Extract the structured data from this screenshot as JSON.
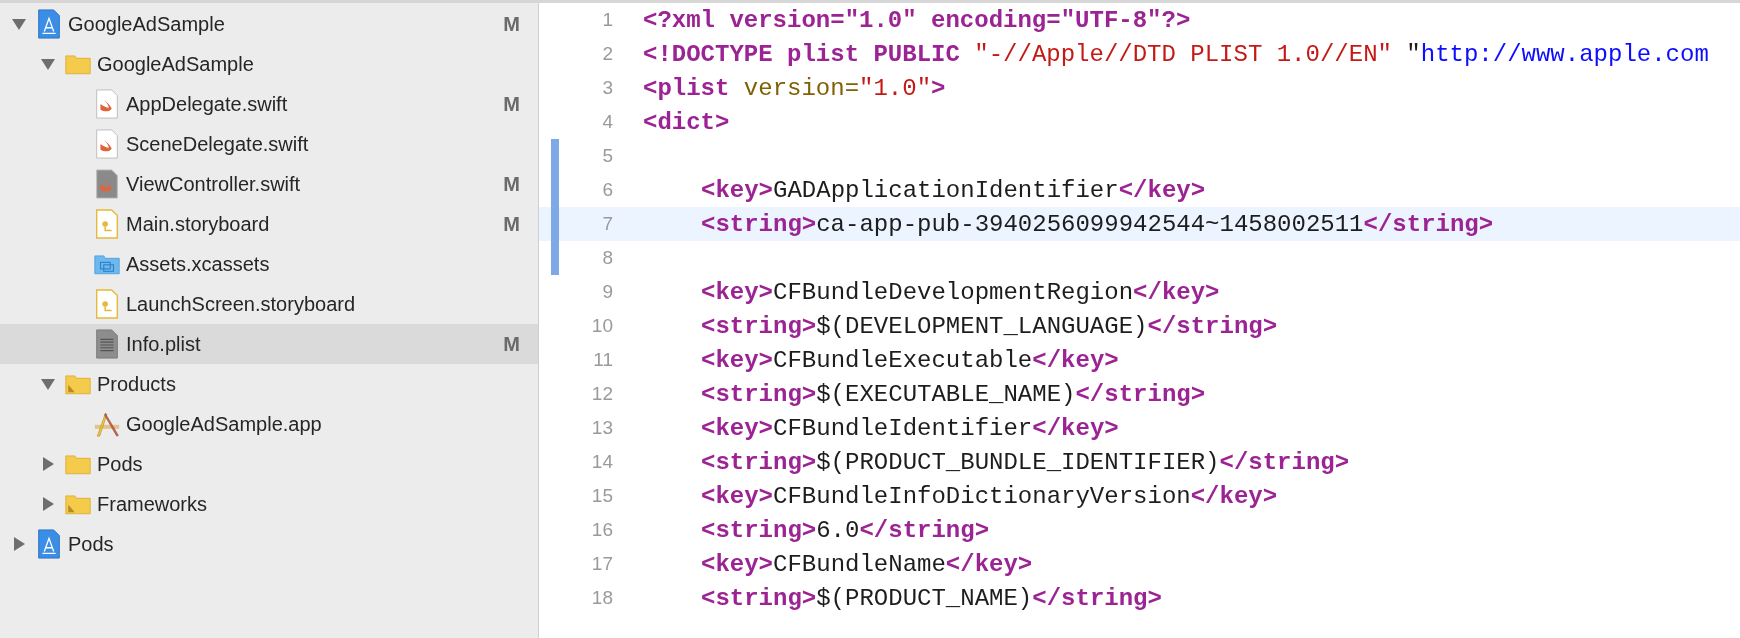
{
  "navigator": {
    "items": [
      {
        "name": "GoogleAdSample",
        "kind": "project",
        "expanded": true,
        "badge": "M",
        "selected": false,
        "children": [
          {
            "name": "GoogleAdSample",
            "kind": "folder",
            "expanded": true,
            "selected": false,
            "children": [
              {
                "name": "AppDelegate.swift",
                "kind": "swift",
                "badge": "M",
                "selected": false
              },
              {
                "name": "SceneDelegate.swift",
                "kind": "swift",
                "selected": false
              },
              {
                "name": "ViewController.swift",
                "kind": "swift-dark",
                "badge": "M",
                "selected": false
              },
              {
                "name": "Main.storyboard",
                "kind": "storyboard",
                "badge": "M",
                "selected": false
              },
              {
                "name": "Assets.xcassets",
                "kind": "assets",
                "selected": false
              },
              {
                "name": "LaunchScreen.storyboard",
                "kind": "storyboard",
                "selected": false
              },
              {
                "name": "Info.plist",
                "kind": "plist",
                "badge": "M",
                "selected": true
              }
            ]
          },
          {
            "name": "Products",
            "kind": "folder-marked",
            "expanded": true,
            "selected": false,
            "children": [
              {
                "name": "GoogleAdSample.app",
                "kind": "app",
                "selected": false
              }
            ]
          },
          {
            "name": "Pods",
            "kind": "folder",
            "expanded": false,
            "selected": false
          },
          {
            "name": "Frameworks",
            "kind": "folder-marked",
            "expanded": false,
            "selected": false
          }
        ]
      },
      {
        "name": "Pods",
        "kind": "project",
        "expanded": false,
        "selected": false
      }
    ]
  },
  "editor": {
    "lines": [
      {
        "number": "1",
        "changed": false,
        "highlighted": false,
        "indented": false,
        "tokens": [
          {
            "kind": "tag",
            "text": "<?xml version=\"1.0\" encoding=\"UTF-8\"?>"
          }
        ]
      },
      {
        "number": "2",
        "changed": false,
        "highlighted": false,
        "indented": false,
        "tokens": [
          {
            "kind": "tag",
            "text": "<!DOCTYPE plist PUBLIC "
          },
          {
            "kind": "string",
            "text": "\"-//Apple//DTD PLIST 1.0//EN\""
          },
          {
            "kind": "plain",
            "text": " \""
          },
          {
            "kind": "url",
            "text": "http://www.apple.com"
          }
        ]
      },
      {
        "number": "3",
        "changed": false,
        "highlighted": false,
        "indented": false,
        "tokens": [
          {
            "kind": "tag",
            "text": "<plist"
          },
          {
            "kind": "attr",
            "text": " version="
          },
          {
            "kind": "string",
            "text": "\"1.0\""
          },
          {
            "kind": "tag",
            "text": ">"
          }
        ]
      },
      {
        "number": "4",
        "changed": false,
        "highlighted": false,
        "indented": false,
        "tokens": [
          {
            "kind": "tag",
            "text": "<dict>"
          }
        ]
      },
      {
        "number": "5",
        "changed": true,
        "highlighted": false,
        "indented": false
      },
      {
        "number": "6",
        "changed": true,
        "highlighted": false,
        "indented": true,
        "tokens": [
          {
            "kind": "tag",
            "text": "<key>"
          },
          {
            "kind": "plain",
            "text": "GADApplicationIdentifier"
          },
          {
            "kind": "tag",
            "text": "</key>"
          }
        ]
      },
      {
        "number": "7",
        "changed": true,
        "highlighted": true,
        "indented": true,
        "tokens": [
          {
            "kind": "tag",
            "text": "<string>"
          },
          {
            "kind": "plain",
            "text": "ca-app-pub-3940256099942544~1458002511"
          },
          {
            "kind": "tag",
            "text": "</string>"
          }
        ]
      },
      {
        "number": "8",
        "changed": true,
        "highlighted": false,
        "indented": false
      },
      {
        "number": "9",
        "changed": false,
        "highlighted": false,
        "indented": true,
        "tokens": [
          {
            "kind": "tag",
            "text": "<key>"
          },
          {
            "kind": "plain",
            "text": "CFBundleDevelopmentRegion"
          },
          {
            "kind": "tag",
            "text": "</key>"
          }
        ]
      },
      {
        "number": "10",
        "changed": false,
        "highlighted": false,
        "indented": true,
        "tokens": [
          {
            "kind": "tag",
            "text": "<string>"
          },
          {
            "kind": "plain",
            "text": "$(DEVELOPMENT_LANGUAGE)"
          },
          {
            "kind": "tag",
            "text": "</string>"
          }
        ]
      },
      {
        "number": "11",
        "changed": false,
        "highlighted": false,
        "indented": true,
        "tokens": [
          {
            "kind": "tag",
            "text": "<key>"
          },
          {
            "kind": "plain",
            "text": "CFBundleExecutable"
          },
          {
            "kind": "tag",
            "text": "</key>"
          }
        ]
      },
      {
        "number": "12",
        "changed": false,
        "highlighted": false,
        "indented": true,
        "tokens": [
          {
            "kind": "tag",
            "text": "<string>"
          },
          {
            "kind": "plain",
            "text": "$(EXECUTABLE_NAME)"
          },
          {
            "kind": "tag",
            "text": "</string>"
          }
        ]
      },
      {
        "number": "13",
        "changed": false,
        "highlighted": false,
        "indented": true,
        "tokens": [
          {
            "kind": "tag",
            "text": "<key>"
          },
          {
            "kind": "plain",
            "text": "CFBundleIdentifier"
          },
          {
            "kind": "tag",
            "text": "</key>"
          }
        ]
      },
      {
        "number": "14",
        "changed": false,
        "highlighted": false,
        "indented": true,
        "tokens": [
          {
            "kind": "tag",
            "text": "<string>"
          },
          {
            "kind": "plain",
            "text": "$(PRODUCT_BUNDLE_IDENTIFIER)"
          },
          {
            "kind": "tag",
            "text": "</string>"
          }
        ]
      },
      {
        "number": "15",
        "changed": false,
        "highlighted": false,
        "indented": true,
        "tokens": [
          {
            "kind": "tag",
            "text": "<key>"
          },
          {
            "kind": "plain",
            "text": "CFBundleInfoDictionaryVersion"
          },
          {
            "kind": "tag",
            "text": "</key>"
          }
        ]
      },
      {
        "number": "16",
        "changed": false,
        "highlighted": false,
        "indented": true,
        "tokens": [
          {
            "kind": "tag",
            "text": "<string>"
          },
          {
            "kind": "plain",
            "text": "6.0"
          },
          {
            "kind": "tag",
            "text": "</string>"
          }
        ]
      },
      {
        "number": "17",
        "changed": false,
        "highlighted": false,
        "indented": true,
        "tokens": [
          {
            "kind": "tag",
            "text": "<key>"
          },
          {
            "kind": "plain",
            "text": "CFBundleName"
          },
          {
            "kind": "tag",
            "text": "</key>"
          }
        ]
      },
      {
        "number": "18",
        "changed": false,
        "highlighted": false,
        "indented": true,
        "tokens": [
          {
            "kind": "tag",
            "text": "<string>"
          },
          {
            "kind": "plain",
            "text": "$(PRODUCT_NAME)"
          },
          {
            "kind": "tag",
            "text": "</string>"
          }
        ]
      }
    ]
  }
}
